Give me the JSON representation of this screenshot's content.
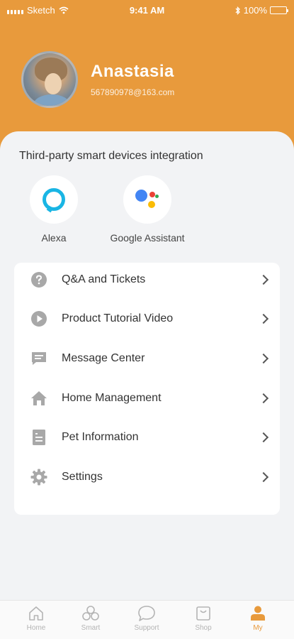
{
  "status_bar": {
    "carrier": "Sketch",
    "time": "9:41 AM",
    "battery": "100%",
    "wifi_icon": "wifi-icon",
    "bluetooth_icon": "bluetooth-icon"
  },
  "profile": {
    "name": "Anastasia",
    "email": "567890978@163.com"
  },
  "integrations": {
    "title": "Third-party smart devices integration",
    "items": [
      {
        "label": "Alexa",
        "icon": "alexa-icon"
      },
      {
        "label": "Google Assistant",
        "icon": "google-assistant-icon"
      }
    ]
  },
  "menu": {
    "items": [
      {
        "label": "Q&A and Tickets",
        "icon": "question-icon"
      },
      {
        "label": "Product Tutorial Video",
        "icon": "play-icon"
      },
      {
        "label": "Message Center",
        "icon": "message-icon"
      },
      {
        "label": "Home Management",
        "icon": "home-icon"
      },
      {
        "label": "Pet Information",
        "icon": "document-icon"
      },
      {
        "label": "Settings",
        "icon": "gear-icon"
      }
    ]
  },
  "tabbar": {
    "items": [
      {
        "label": "Home",
        "icon": "home-icon"
      },
      {
        "label": "Smart",
        "icon": "smart-icon"
      },
      {
        "label": "Support",
        "icon": "chat-icon"
      },
      {
        "label": "Shop",
        "icon": "shop-icon"
      },
      {
        "label": "My",
        "icon": "user-icon",
        "active": true
      }
    ]
  },
  "colors": {
    "accent": "#E89A3C",
    "background": "#F2F3F5",
    "icon_gray": "#A8A8A8",
    "tab_inactive": "#B4B4B4"
  }
}
